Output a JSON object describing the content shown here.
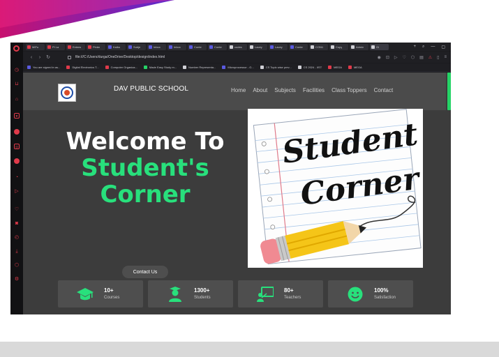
{
  "browser": {
    "tabs": [
      {
        "label": "MIFu",
        "color": "#e03a4a"
      },
      {
        "label": "Pi La",
        "color": "#e03a4a"
      },
      {
        "label": "Extens",
        "color": "#e03a4a"
      },
      {
        "label": "Pinter",
        "color": "#e03a4a"
      },
      {
        "label": "Kaibo",
        "color": "#5a5ae0"
      },
      {
        "label": "Subje",
        "color": "#5a5ae0"
      },
      {
        "label": "Inbox",
        "color": "#5a5ae0"
      },
      {
        "label": "Inbox",
        "color": "#5a5ae0"
      },
      {
        "label": "Conte",
        "color": "#5a5ae0"
      },
      {
        "label": "Conte",
        "color": "#5a5ae0"
      },
      {
        "label": "codes",
        "color": "#d0d0d6"
      },
      {
        "label": "Lacey",
        "color": "#d0d0d6"
      },
      {
        "label": "Lacey",
        "color": "#5a5ae0"
      },
      {
        "label": "Conte",
        "color": "#5a5ae0"
      },
      {
        "label": "CON1",
        "color": "#d0d0d6"
      },
      {
        "label": "Copy",
        "color": "#d0d0d6"
      },
      {
        "label": "Admin",
        "color": "#d0d0d6"
      },
      {
        "label": "Gi",
        "color": "#d0d0d6"
      }
    ],
    "new_tab": "+",
    "url": "file:///C:/Users/durga/OneDrive/Desktop/design/index.html",
    "bookmarks": [
      {
        "label": "You are signed in as...",
        "color": "#5a5ae0"
      },
      {
        "label": "Digital Electronics T...",
        "color": "#e03a4a"
      },
      {
        "label": "Computer Organiza...",
        "color": "#e03a4a"
      },
      {
        "label": "Made Easy Study m...",
        "color": "#25d366"
      },
      {
        "label": "Number Representa...",
        "color": "#d0d0d6"
      },
      {
        "label": "Microprocessor - G...",
        "color": "#5a5ae0"
      },
      {
        "label": "CS Topic wise prev...",
        "color": "#d0d0d6"
      },
      {
        "label": "CS 2024 - IIST",
        "color": "#d0d0d6"
      },
      {
        "label": "MEGA",
        "color": "#e03a4a"
      },
      {
        "label": "MEGA",
        "color": "#e03a4a"
      }
    ]
  },
  "site": {
    "school_name": "DAV PUBLIC SCHOOL",
    "nav": [
      "Home",
      "About",
      "Subjects",
      "Facilities",
      "Class Toppers",
      "Contact"
    ],
    "hero": {
      "line1": "Welcome To",
      "line2": "Student's",
      "line3": "Corner",
      "cta": "Contact Us"
    },
    "image_text": {
      "line1": "Student",
      "line2": "Corner"
    },
    "stats": [
      {
        "value": "10+",
        "label": "Courses",
        "icon": "graduation-cap-icon"
      },
      {
        "value": "1300+",
        "label": "Students",
        "icon": "student-icon"
      },
      {
        "value": "80+",
        "label": "Teachers",
        "icon": "teacher-icon"
      },
      {
        "value": "100%",
        "label": "Satisfaction",
        "icon": "smile-icon"
      }
    ]
  },
  "colors": {
    "accent_green": "#28e07c",
    "header_bg": "#4b4b4b",
    "page_bg": "#3c3c3c",
    "browser_accent": "#e03a4a"
  }
}
